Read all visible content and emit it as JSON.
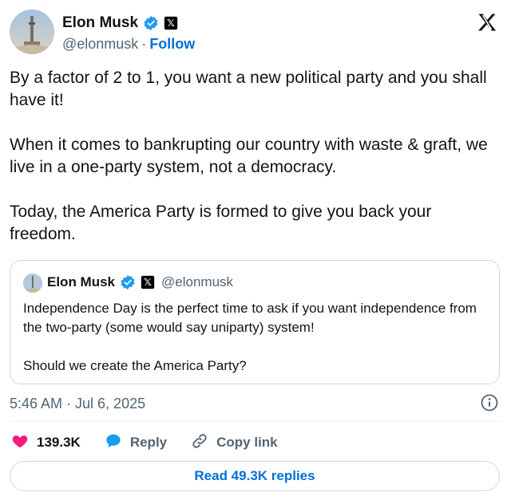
{
  "author": {
    "name": "Elon Musk",
    "handle": "@elonmusk",
    "separator": "·",
    "follow_label": "Follow",
    "x_badge": "𝕏"
  },
  "tweet": {
    "text": "By a factor of 2 to 1, you want a new political party and you shall have it!\n\nWhen it comes to bankrupting our country with waste & graft, we live in a one-party system, not a democracy.\n\nToday, the America Party is formed to give you back your freedom."
  },
  "quote": {
    "name": "Elon Musk",
    "handle": "@elonmusk",
    "x_badge": "𝕏",
    "text": "Independence Day is the perfect time to ask if you want independence from the two-party (some would say uniparty) system!\n\nShould we create the America Party?"
  },
  "meta": {
    "timestamp": "5:46 AM · Jul 6, 2025"
  },
  "actions": {
    "likes": "139.3K",
    "reply_label": "Reply",
    "copy_link_label": "Copy link"
  },
  "read_replies_label": "Read 49.3K replies",
  "icons": {
    "verified": "verified-badge-icon",
    "x_logo": "x-logo-icon",
    "info": "info-icon",
    "like": "heart-icon",
    "reply": "reply-bubble-icon",
    "copy_link": "link-icon"
  },
  "colors": {
    "verified": "#1d9bf0",
    "like": "#f91880",
    "reply": "#1d9bf0",
    "link_blue": "#006fd6",
    "secondary_text": "#536471",
    "border": "#cfd9de"
  }
}
